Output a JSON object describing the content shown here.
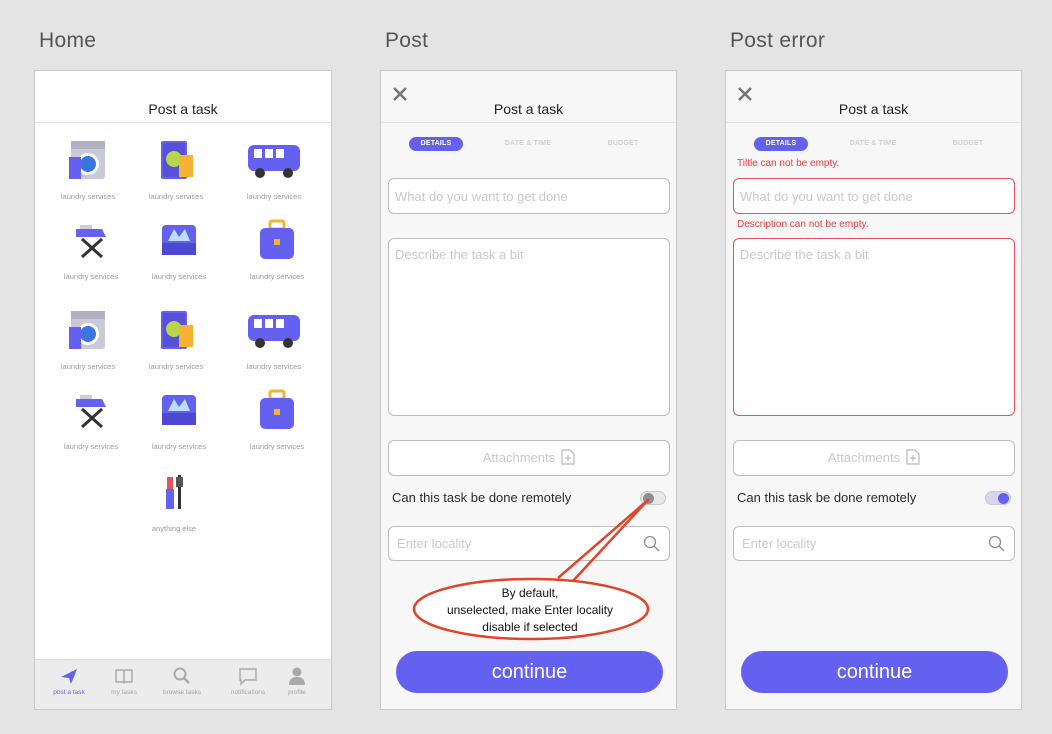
{
  "screens": {
    "home_label": "Home",
    "post_label": "Post",
    "error_label": "Post error"
  },
  "home": {
    "title": "Post a task",
    "tiles": [
      {
        "label": "laundry services",
        "icon": "washing-machine-icon"
      },
      {
        "label": "laundry services",
        "icon": "book-cup-icon"
      },
      {
        "label": "laundry services",
        "icon": "van-icon"
      },
      {
        "label": "laundry services",
        "icon": "iron-icon"
      },
      {
        "label": "laundry services",
        "icon": "sofa-icon"
      },
      {
        "label": "laundry services",
        "icon": "briefcase-icon"
      },
      {
        "label": "laundry services",
        "icon": "washing-machine-icon"
      },
      {
        "label": "laundry services",
        "icon": "book-cup-icon"
      },
      {
        "label": "laundry services",
        "icon": "van-icon"
      },
      {
        "label": "laundry services",
        "icon": "iron-icon"
      },
      {
        "label": "laundry services",
        "icon": "sofa-icon"
      },
      {
        "label": "laundry services",
        "icon": "briefcase-icon"
      },
      {
        "label": "anything else",
        "icon": "lipstick-icon"
      }
    ],
    "tabs": [
      {
        "label": "post a task",
        "icon": "paper-plane-icon",
        "active": true
      },
      {
        "label": "my tasks",
        "icon": "book-icon"
      },
      {
        "label": "browse tasks",
        "icon": "search-icon"
      },
      {
        "label": "notifications",
        "icon": "chat-icon"
      },
      {
        "label": "profile",
        "icon": "user-icon"
      }
    ]
  },
  "post": {
    "title": "Post a task",
    "steps": [
      "DETAILS",
      "DATE & TIME",
      "BUDGET"
    ],
    "title_placeholder": "What do you want to get done",
    "description_placeholder": "Describe the task a bit",
    "attachments_label": "Attachments",
    "remote_label": "Can this task be done remotely",
    "remote_on": false,
    "locality_placeholder": "Enter locality",
    "continue_label": "continue"
  },
  "post_error": {
    "title": "Post a task",
    "steps": [
      "DETAILS",
      "DATE & TIME",
      "BUDGET"
    ],
    "title_error": "Tiltle can not be empty.",
    "description_error": "Description can not be empty.",
    "title_placeholder": "What do you want to get done",
    "description_placeholder": "Describe the task a bit",
    "attachments_label": "Attachments",
    "remote_label": "Can this task be done remotely",
    "remote_on": true,
    "locality_placeholder": "Enter locality",
    "continue_label": "continue"
  },
  "annotation": {
    "line1": "By default,",
    "line2": "unselected, make Enter locality",
    "line3": "disable if selected"
  },
  "colors": {
    "accent": "#6561f0",
    "error": "#ec3d3d",
    "annotation": "#e2442a"
  }
}
